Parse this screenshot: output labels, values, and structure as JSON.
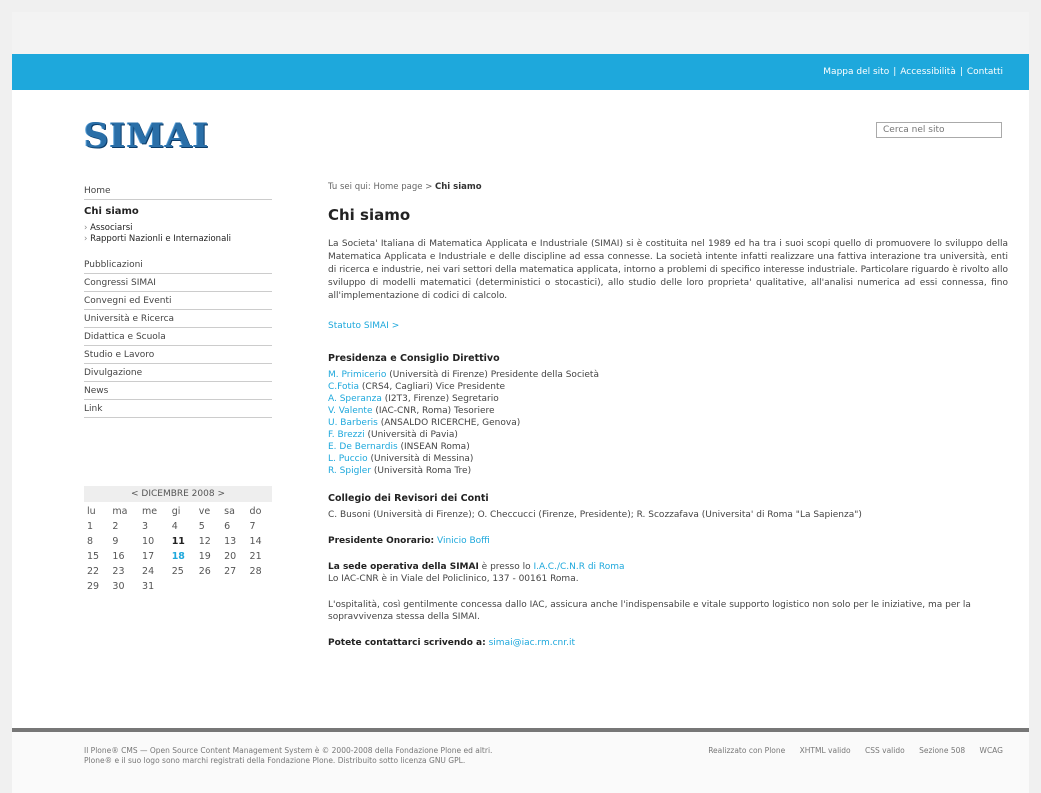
{
  "topbar": {
    "links": [
      "Mappa del sito",
      "Accessibilità",
      "Contatti"
    ],
    "separator": "|"
  },
  "header": {
    "logo_text": "SIMAI",
    "search_placeholder": "Cerca nel sito"
  },
  "sidebar": {
    "items": [
      {
        "label": "Home"
      },
      {
        "label": "Chi siamo",
        "active": true,
        "children": [
          "Associarsi",
          "Rapporti Nazionli e Internazionali"
        ]
      },
      {
        "label": "Pubblicazioni"
      },
      {
        "label": "Congressi SIMAI"
      },
      {
        "label": "Convegni ed Eventi"
      },
      {
        "label": "Università e Ricerca"
      },
      {
        "label": "Didattica e Scuola"
      },
      {
        "label": "Studio e Lavoro"
      },
      {
        "label": "Divulgazione"
      },
      {
        "label": "News"
      },
      {
        "label": "Link"
      }
    ]
  },
  "calendar": {
    "prev": "<",
    "month": "DICEMBRE 2008",
    "next": ">",
    "days": [
      "lu",
      "ma",
      "me",
      "gi",
      "ve",
      "sa",
      "do"
    ],
    "weeks": [
      [
        "1",
        "2",
        "3",
        "4",
        "5",
        "6",
        "7"
      ],
      [
        "8",
        "9",
        "10",
        "11",
        "12",
        "13",
        "14"
      ],
      [
        "15",
        "16",
        "17",
        "18",
        "19",
        "20",
        "21"
      ],
      [
        "22",
        "23",
        "24",
        "25",
        "26",
        "27",
        "28"
      ],
      [
        "29",
        "30",
        "31",
        "",
        "",
        "",
        ""
      ]
    ],
    "bold_day": "11",
    "today": "18"
  },
  "content": {
    "breadcrumb_prefix": "Tu sei qui:",
    "breadcrumb_home": "Home page",
    "breadcrumb_sep": ">",
    "breadcrumb_current": "Chi siamo",
    "title": "Chi siamo",
    "intro": "La Societa' Italiana di Matematica Applicata e Industriale (SIMAI) si è costituita nel 1989 ed ha tra i suoi scopi quello di promuovere lo sviluppo della Matematica Applicata e Industriale e delle discipline ad essa connesse. La società intente infatti realizzare una fattiva interazione tra università, enti di ricerca e industrie, nei vari settori della matematica applicata, intorno a problemi di specifico interesse industriale. Particolare riguardo è rivolto allo sviluppo di modelli matematici (deterministici o stocastici), allo studio delle loro proprieta' qualitative, all'analisi numerica ad essi connessa, fino all'implementazione di codici di calcolo.",
    "statuto_link": "Statuto SIMAI >",
    "presidenza_title": "Presidenza e Consiglio Direttivo",
    "members": [
      {
        "name": "M. Primicerio",
        "info": " (Università di Firenze) Presidente della Società"
      },
      {
        "name": "C.Fotia",
        "info": " (CRS4, Cagliari) Vice Presidente"
      },
      {
        "name": "A. Speranza",
        "info": " (I2T3, Firenze) Segretario"
      },
      {
        "name": "V. Valente",
        "info": " (IAC-CNR, Roma) Tesoriere"
      },
      {
        "name": "U. Barberis",
        "info": " (ANSALDO RICERCHE, Genova)"
      },
      {
        "name": "F. Brezzi",
        "info": " (Università di Pavia)"
      },
      {
        "name": "E. De Bernardis",
        "info": " (INSEAN Roma)"
      },
      {
        "name": "L. Puccio",
        "info": " (Università di Messina)"
      },
      {
        "name": "R. Spigler",
        "info": " (Università Roma Tre)"
      }
    ],
    "collegio_title": "Collegio dei Revisori dei Conti",
    "collegio_text": "C. Busoni (Università di Firenze); O. Checcucci (Firenze, Presidente); R. Scozzafava (Universita' di Roma \"La Sapienza\")",
    "onorario_label": "Presidente Onorario:",
    "onorario_name": "Vinicio Boffi",
    "sede_label": "La sede operativa della SIMAI",
    "sede_mid": " è presso lo ",
    "sede_link": "I.A.C./C.N.R di Roma",
    "sede_address": "Lo IAC-CNR è in Viale del Policlinico, 137 - 00161 Roma.",
    "ospitalita": "L'ospitalità, così gentilmente concessa dallo IAC, assicura anche l'indispensabile e vitale supporto logistico non solo per le iniziative, ma per la sopravvivenza stessa della SIMAI.",
    "contact_label": "Potete contattarci scrivendo a:",
    "contact_email": "simai@iac.rm.cnr.it"
  },
  "footer": {
    "line1": "Il Plone® CMS — Open Source Content Management System è © 2000-2008 della Fondazione Plone ed altri.",
    "line2": "Plone® e il suo logo sono marchi registrati della Fondazione Plone. Distribuito sotto licenza GNU GPL.",
    "links": [
      "Realizzato con Plone",
      "XHTML valido",
      "CSS valido",
      "Sezione 508",
      "WCAG"
    ]
  },
  "colors": {
    "accent": "#1ea8dc",
    "footer_bar": "#777777"
  }
}
